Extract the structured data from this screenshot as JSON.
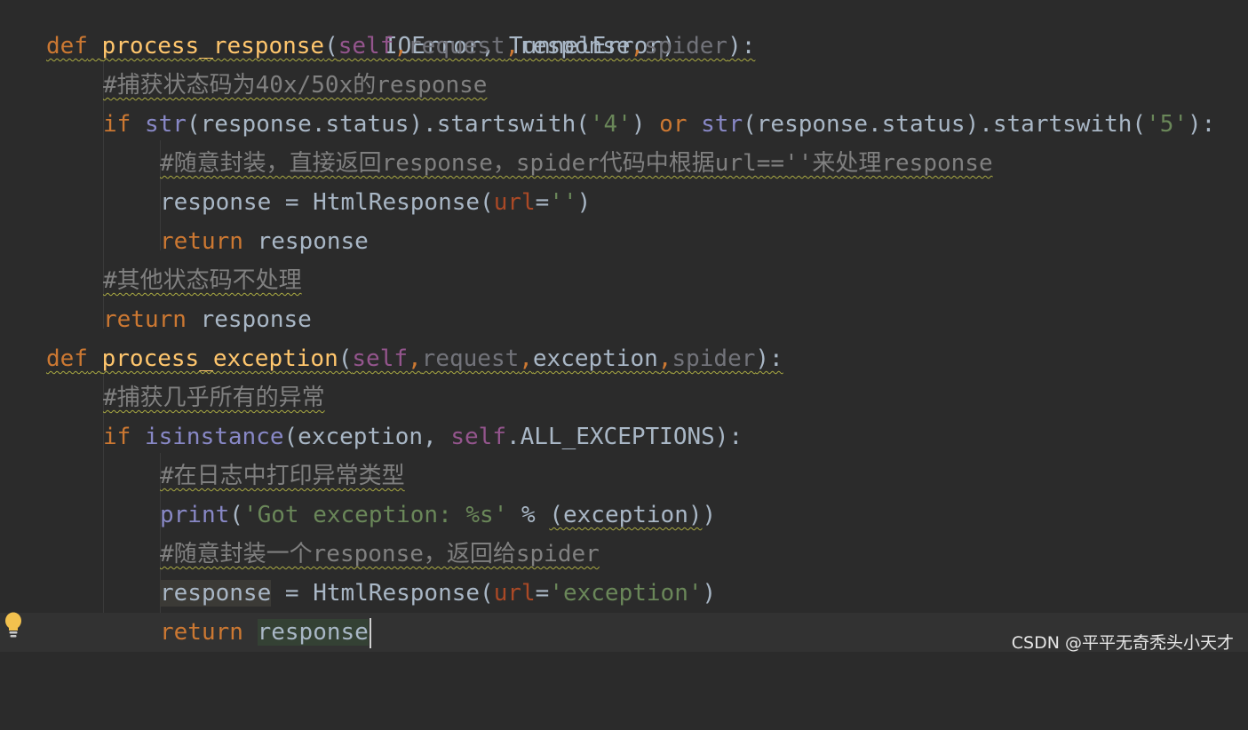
{
  "editor": {
    "language": "python",
    "lines": [
      {
        "tokens": [
          "IOError,",
          "TunnelError)"
        ]
      },
      {
        "tokens": [
          "def",
          "process_response",
          "(",
          "self",
          ",",
          "request",
          ",",
          "response",
          ",",
          "spider",
          "):"
        ]
      },
      {
        "tokens": [
          "#捕获状态码为40x/50x的response"
        ]
      },
      {
        "tokens": [
          "if",
          "str",
          "(response.status).startswith(",
          "'4'",
          ")",
          "or",
          "str",
          "(response.status).startswith(",
          "'5'",
          "):"
        ]
      },
      {
        "tokens": [
          "#随意封装，直接返回response，spider代码中根据url==''来处理response"
        ]
      },
      {
        "tokens": [
          "response = HtmlResponse(",
          "url",
          "=",
          "''",
          ")"
        ]
      },
      {
        "tokens": [
          "return",
          "response"
        ]
      },
      {
        "tokens": [
          "#其他状态码不处理"
        ]
      },
      {
        "tokens": [
          "return",
          "response"
        ]
      },
      {
        "tokens": [
          "def",
          "process_exception",
          "(",
          "self",
          ",",
          "request",
          ",",
          "exception",
          ",",
          "spider",
          "):"
        ]
      },
      {
        "tokens": [
          "#捕获几乎所有的异常"
        ]
      },
      {
        "tokens": [
          "if",
          "isinstance",
          "(exception, ",
          "self",
          ".ALL_EXCEPTIONS):"
        ]
      },
      {
        "tokens": [
          "#在日志中打印异常类型"
        ]
      },
      {
        "tokens": [
          "print",
          "(",
          "'Got exception: %s'",
          " % ",
          "(exception)",
          ")"
        ]
      },
      {
        "tokens": [
          "#随意封装一个response，返回给spider"
        ]
      },
      {
        "tokens": [
          "response",
          " = HtmlResponse(",
          "url",
          "=",
          "'exception'",
          ")"
        ]
      },
      {
        "tokens": [
          "return",
          "response"
        ]
      }
    ]
  },
  "gutter": {
    "icon": "lightbulb-icon"
  },
  "watermark": "CSDN @平平无奇秃头小天才",
  "colors": {
    "background": "#2b2b2b",
    "keyword": "#cc7832",
    "function": "#ffc66d",
    "self": "#94558d",
    "string": "#6a8759",
    "comment": "#808080",
    "builtin": "#8888c6"
  }
}
